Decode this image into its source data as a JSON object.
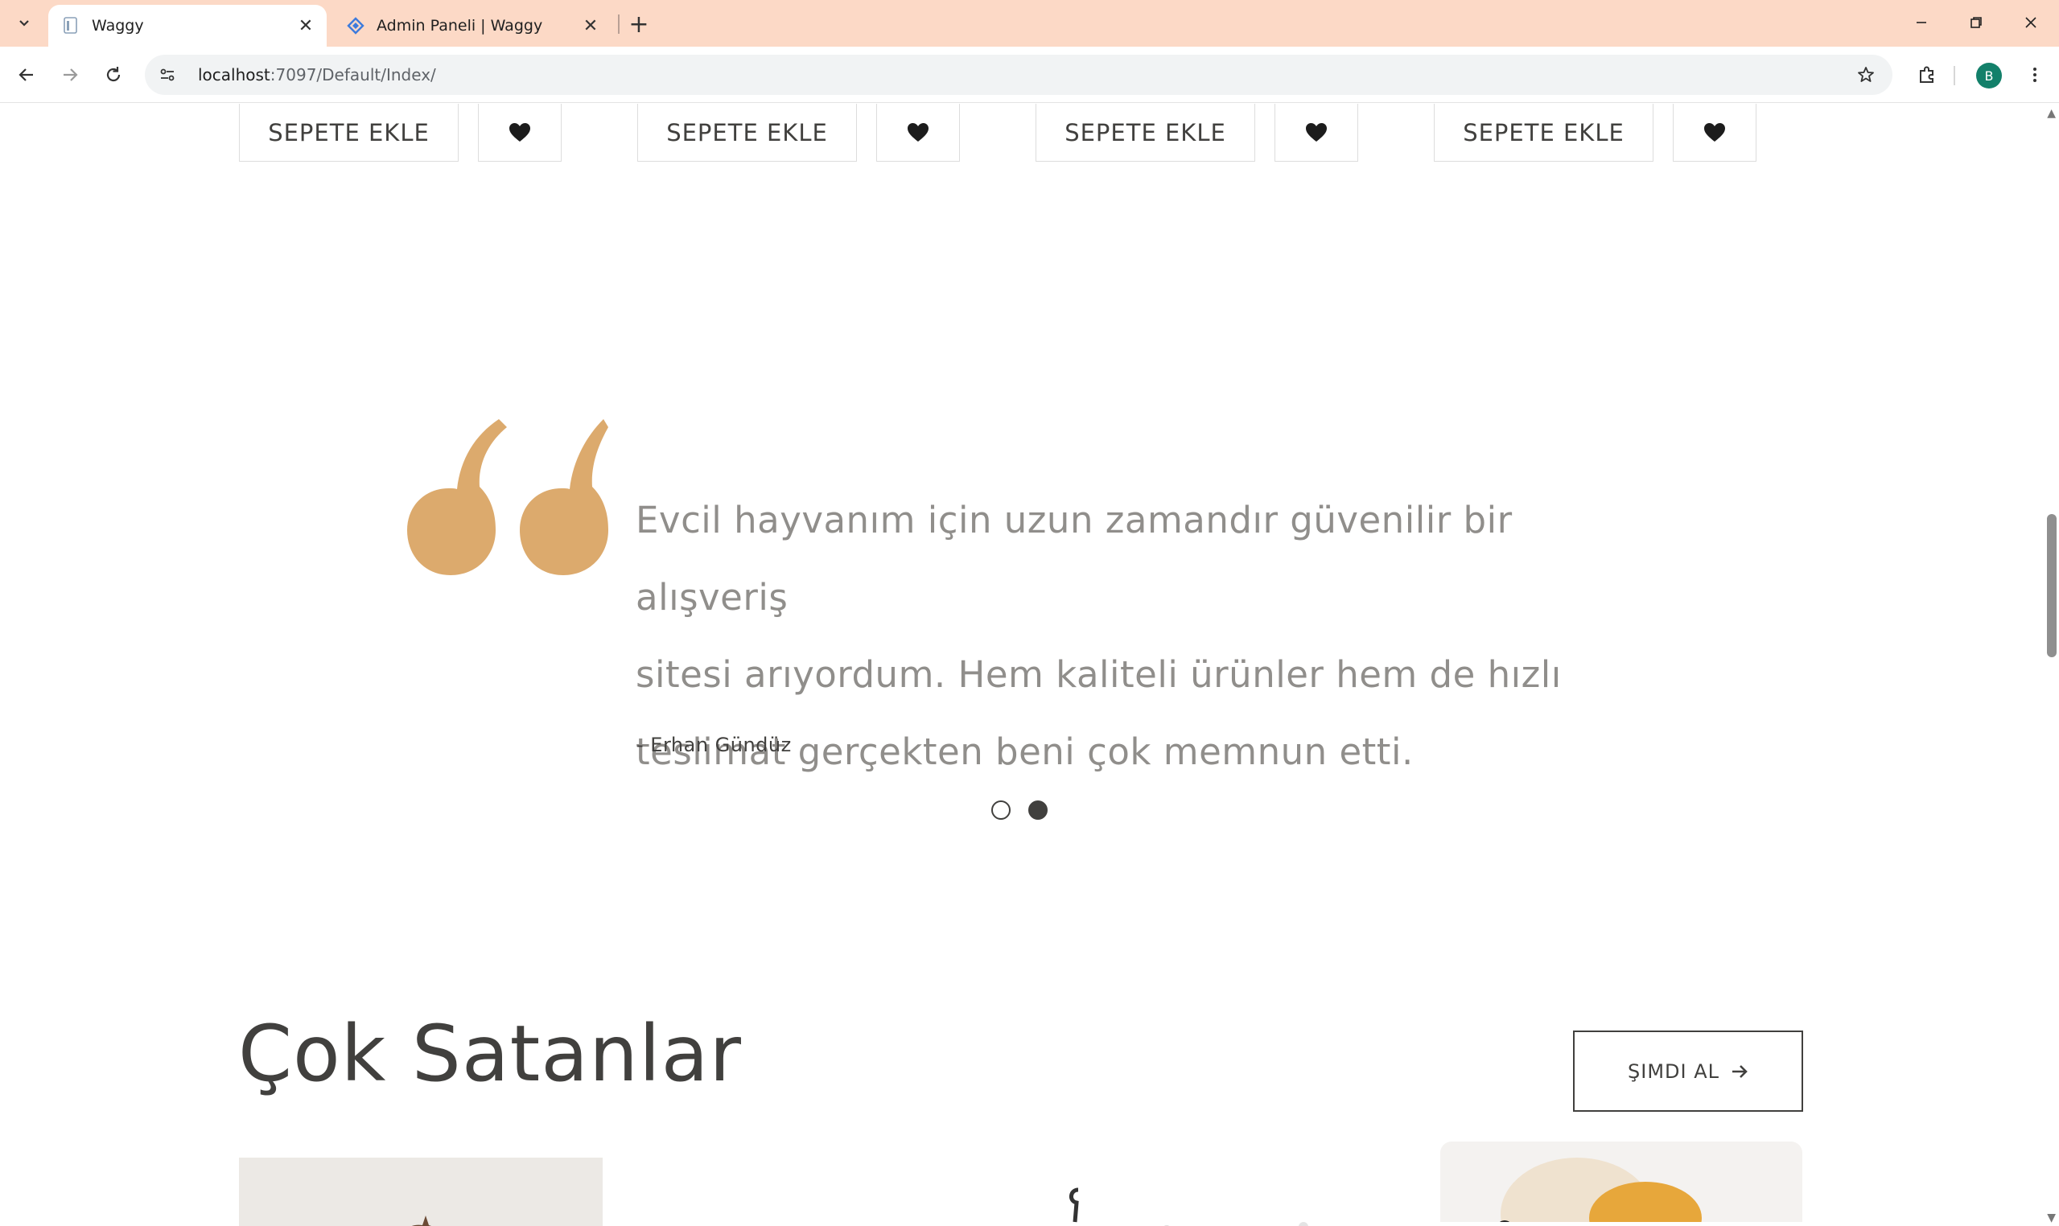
{
  "browser": {
    "tabs": [
      {
        "title": "Waggy",
        "active": true
      },
      {
        "title": "Admin Paneli | Waggy",
        "active": false
      }
    ],
    "url_host": "localhost",
    "url_rest": ":7097/Default/Index/",
    "profile_initial": "B"
  },
  "products_row": {
    "add_to_cart_label": "SEPETE EKLE",
    "items": [
      {
        "cart_label": "SEPETE EKLE"
      },
      {
        "cart_label": "SEPETE EKLE"
      },
      {
        "cart_label": "SEPETE EKLE"
      },
      {
        "cart_label": "SEPETE EKLE"
      }
    ]
  },
  "testimonial": {
    "lines": [
      "Evcil hayvanım için uzun zamandır güvenilir bir alışveriş",
      "sitesi arıyordum. Hem kaliteli ürünler hem de hızlı",
      "teslimat gerçekten beni çok memnun etti."
    ],
    "author": "- Erhan Gündüz",
    "active_slide": 2,
    "slide_count": 2,
    "quote_color": "#dcaa6d"
  },
  "best_sellers": {
    "title": "Çok Satanlar",
    "shop_now_label": "ŞIMDI AL"
  },
  "colors": {
    "tabbar_bg": "#fcd9c6",
    "text_dark": "#41403e",
    "text_muted": "#908e8b",
    "accent": "#dcaa6d"
  }
}
